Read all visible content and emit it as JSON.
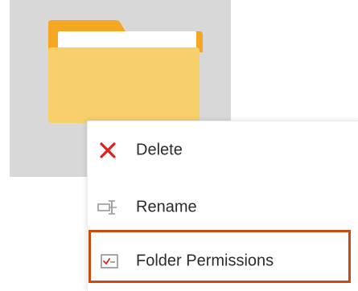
{
  "folder": {
    "icon": "folder-icon",
    "colors": {
      "tile_background": "#d8d8d8",
      "folder_back": "#f5a623",
      "folder_front": "#f7cf6b",
      "paper": "#ffffff"
    }
  },
  "context_menu": {
    "items": [
      {
        "label": "Delete",
        "icon": "close-icon",
        "icon_color": "#e0201b"
      },
      {
        "label": "Rename",
        "icon": "rename-icon",
        "icon_color": "#9a9a9a"
      },
      {
        "label": "Folder Permissions",
        "icon": "checkbox-permissions-icon",
        "icon_color": "#e0201b",
        "highlighted": true
      }
    ]
  },
  "colors": {
    "highlight_border": "#cc4a12",
    "menu_text": "#2b2b2b",
    "menu_background": "#ffffff"
  }
}
